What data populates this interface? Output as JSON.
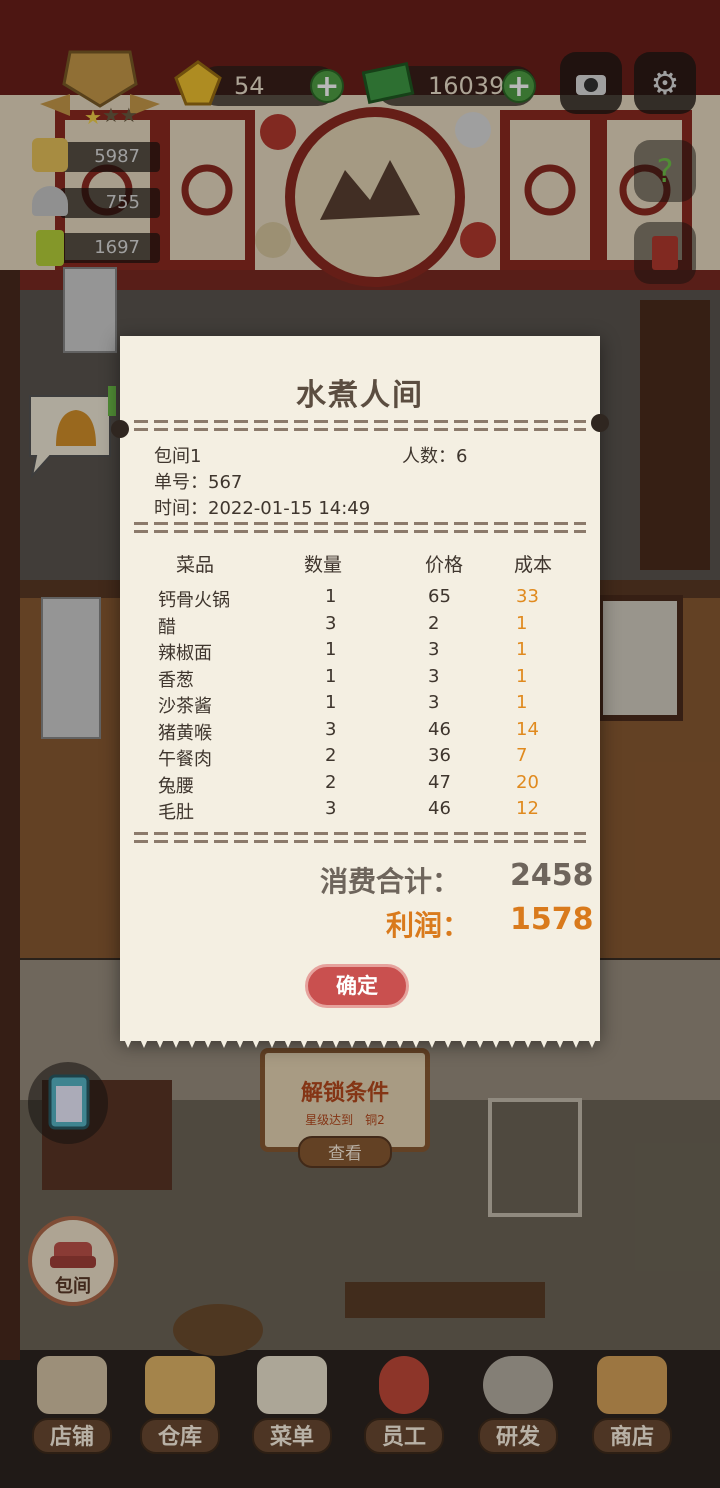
{
  "hud": {
    "gems": "54",
    "cash": "16039",
    "stats": [
      "5987",
      "755",
      "1697"
    ]
  },
  "receipt": {
    "title": "水煮人间",
    "room": "包间1",
    "guests": "人数：6",
    "order_no": "单号：567",
    "time": "时间：2022-01-15 14:49",
    "headers": [
      "菜品",
      "数量",
      "价格",
      "成本"
    ],
    "items": [
      {
        "name": "钙骨火锅",
        "qty": "1",
        "price": "65",
        "cost": "33"
      },
      {
        "name": "醋",
        "qty": "3",
        "price": "2",
        "cost": "1"
      },
      {
        "name": "辣椒面",
        "qty": "1",
        "price": "3",
        "cost": "1"
      },
      {
        "name": "香葱",
        "qty": "1",
        "price": "3",
        "cost": "1"
      },
      {
        "name": "沙茶酱",
        "qty": "1",
        "price": "3",
        "cost": "1"
      },
      {
        "name": "猪黄喉",
        "qty": "3",
        "price": "46",
        "cost": "14"
      },
      {
        "name": "午餐肉",
        "qty": "2",
        "price": "36",
        "cost": "7"
      },
      {
        "name": "兔腰",
        "qty": "2",
        "price": "47",
        "cost": "20"
      },
      {
        "name": "毛肚",
        "qty": "3",
        "price": "46",
        "cost": "12"
      }
    ],
    "total_label": "消费合计：",
    "total_value": "2458",
    "profit_label": "利润：",
    "profit_value": "1578",
    "confirm": "确定"
  },
  "unlock": {
    "title": "解锁条件",
    "subtitle": "星级达到　铜2",
    "view": "查看"
  },
  "room_button": "包间",
  "nav": [
    "店铺",
    "仓库",
    "菜单",
    "员工",
    "研发",
    "商店"
  ],
  "colors": {
    "cost": "#e08a1e",
    "profit": "#d97a1c",
    "confirm": "#c9504f",
    "plus": "#4fa044"
  }
}
